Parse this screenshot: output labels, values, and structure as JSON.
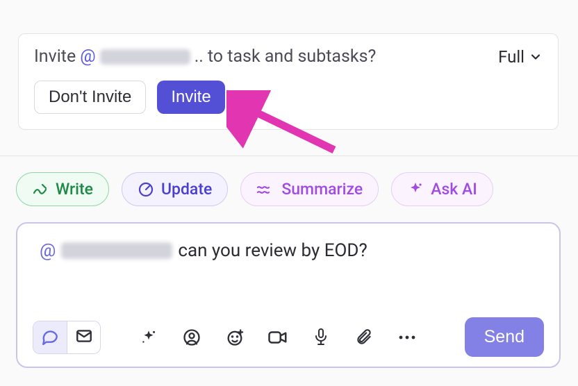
{
  "invite": {
    "prefix": "Invite",
    "at": "@",
    "dots": "..",
    "suffix": "to task and subtasks?",
    "full_label": "Full",
    "dont_invite_label": "Don't Invite",
    "invite_label": "Invite"
  },
  "pills": {
    "write": "Write",
    "update": "Update",
    "summarize": "Summarize",
    "ask_ai": "Ask AI"
  },
  "composer": {
    "at": "@",
    "text_after": "can you review by EOD?",
    "send_label": "Send"
  },
  "colors": {
    "primary": "#5450d6",
    "arrow": "#e235b1"
  }
}
